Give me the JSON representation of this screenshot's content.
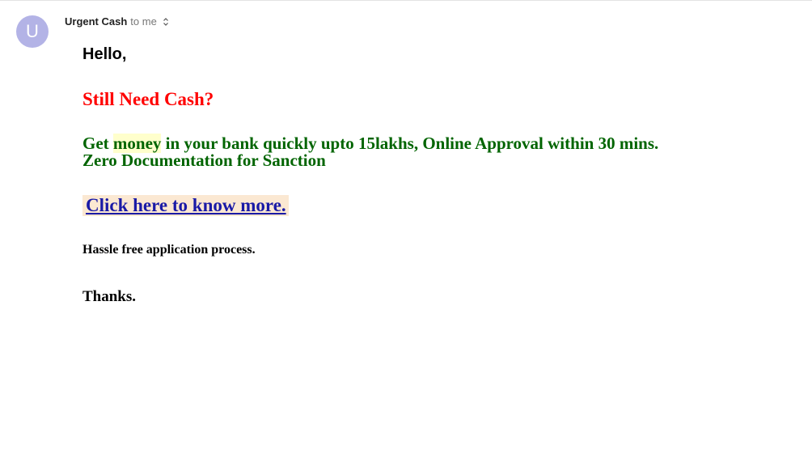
{
  "header": {
    "avatar_letter": "U",
    "avatar_color": "#b3b3e6",
    "sender_name": "Urgent Cash",
    "recipient_text": "to me",
    "details_icon": "chevron-up-down-icon"
  },
  "message": {
    "greeting": "Hello,",
    "headline": "Still Need Cash?",
    "offer_before": "Get ",
    "offer_highlight": "money",
    "offer_after": " in your bank quickly upto 15lakhs, Online Approval within 30 mins.",
    "offer_line2": "Zero Documentation for Sanction",
    "link_text": "Click here to know more.",
    "note": "Hassle free application process.",
    "signoff": "Thanks."
  },
  "colors": {
    "headline": "#ff0000",
    "offer": "#006400",
    "highlight": "#ffffcc",
    "link": "#1a1aa6",
    "link_background": "#fbe8d2"
  }
}
